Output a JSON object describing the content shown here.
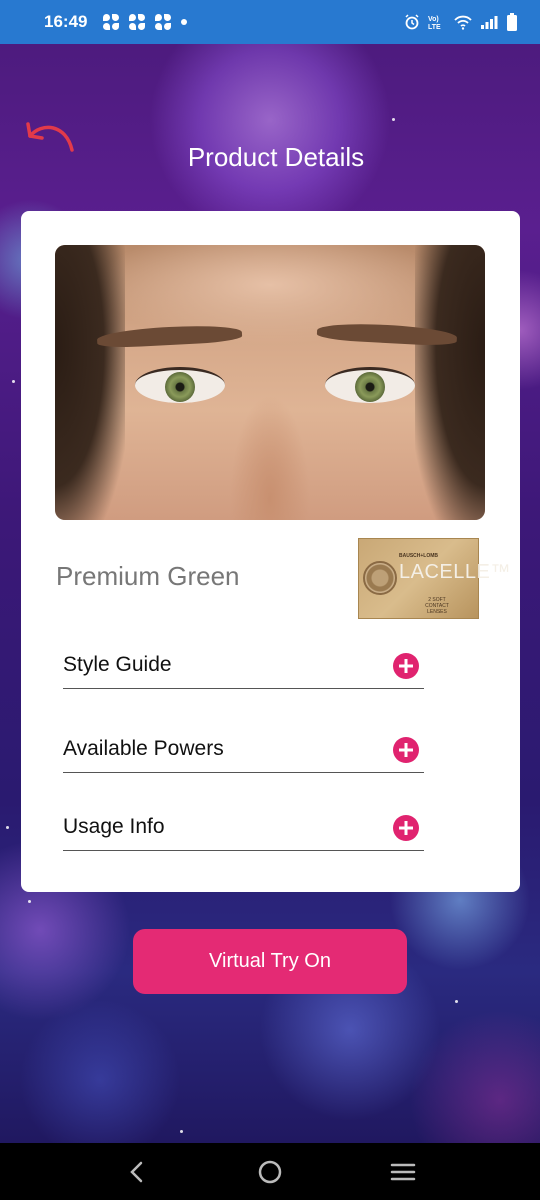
{
  "status_bar": {
    "time": "16:49",
    "network_label": "Vo) LTE",
    "icons": [
      "fan-icon",
      "fan-icon",
      "fan-icon",
      "notification-dot-icon",
      "alarm-icon",
      "volte-icon",
      "wifi-icon",
      "signal-icon",
      "battery-icon"
    ]
  },
  "header": {
    "title": "Product Details",
    "back_icon": "undo-arrow-icon"
  },
  "product": {
    "name": "Premium Green",
    "package": {
      "brand": "BAUSCH+LOMB",
      "logo_text": "LACELLE™",
      "subtitle": "2 SOFT CONTACT LENSES"
    }
  },
  "accordion": [
    {
      "label": "Style Guide",
      "icon": "plus-circle-icon"
    },
    {
      "label": "Available Powers",
      "icon": "plus-circle-icon"
    },
    {
      "label": "Usage Info",
      "icon": "plus-circle-icon"
    }
  ],
  "cta": {
    "label": "Virtual Try On"
  },
  "nav_bar": {
    "icons": [
      "back-icon",
      "home-icon",
      "recents-icon"
    ]
  },
  "colors": {
    "status_bar": "#2879d0",
    "accent": "#e42a74",
    "card": "#ffffff",
    "nav_bar": "#000000"
  }
}
